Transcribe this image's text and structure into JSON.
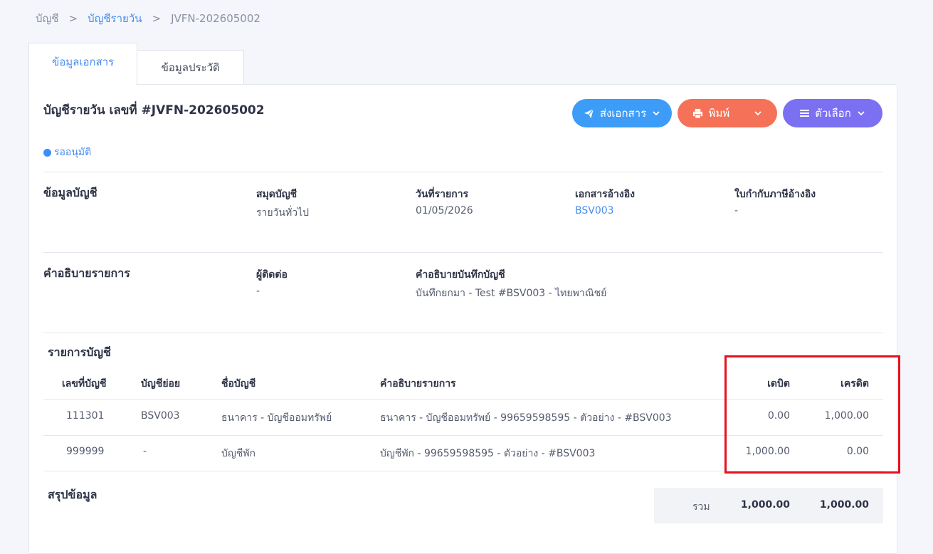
{
  "breadcrumb": {
    "root": "บัญชี",
    "sep1": ">",
    "parent": "บัญชีรายวัน",
    "sep2": ">",
    "current": "JVFN-202605002"
  },
  "tabs": {
    "doc": "ข้อมูลเอกสาร",
    "history": "ข้อมูลประวัติ"
  },
  "document": {
    "title": "บัญชีรายวัน เลขที่ #JVFN-202605002",
    "status": "รออนุมัติ"
  },
  "actions": {
    "send": "ส่งเอกสาร",
    "print": "พิมพ์",
    "options": "ตัวเลือก"
  },
  "account_info": {
    "title": "ข้อมูลบัญชี",
    "book_label": "สมุดบัญชี",
    "book_value": "รายวันทั่วไป",
    "date_label": "วันที่รายการ",
    "date_value": "01/05/2026",
    "ref_label": "เอกสารอ้างอิง",
    "ref_value": "BSV003",
    "tax_label": "ใบกำกับภาษีอ้างอิง",
    "tax_value": "-"
  },
  "description": {
    "title": "คำอธิบายรายการ",
    "contact_label": "ผู้ติดต่อ",
    "contact_value": "-",
    "note_label": "คำอธิบายบันทึกบัญชี",
    "note_value": "บันทึกยกมา - Test #BSV003 - ไทยพาณิชย์"
  },
  "entries": {
    "title": "รายการบัญชี",
    "headers": {
      "code": "เลขที่บัญชี",
      "sub": "บัญชีย่อย",
      "name": "ชื่อบัญชี",
      "desc": "คำอธิบายรายการ",
      "debit": "เดบิต",
      "credit": "เครดิต"
    },
    "rows": [
      {
        "code": "111301",
        "sub": "BSV003",
        "name": "ธนาคาร - บัญชีออมทรัพย์",
        "desc": "ธนาคาร - บัญชีออมทรัพย์ - 99659598595 - ตัวอย่าง - #BSV003",
        "debit": "0.00",
        "credit": "1,000.00"
      },
      {
        "code": "999999",
        "sub": "-",
        "name": "บัญชีพัก",
        "desc": "บัญชีพัก - 99659598595 - ตัวอย่าง - #BSV003",
        "debit": "1,000.00",
        "credit": "0.00"
      }
    ]
  },
  "summary": {
    "title": "สรุปข้อมูล",
    "total_label": "รวม",
    "total_debit": "1,000.00",
    "total_credit": "1,000.00"
  },
  "colors": {
    "primary": "#4a8cf0",
    "send": "#3c9cf7",
    "print": "#f57157",
    "options": "#7b6ff2",
    "highlight": "#e8111d"
  }
}
